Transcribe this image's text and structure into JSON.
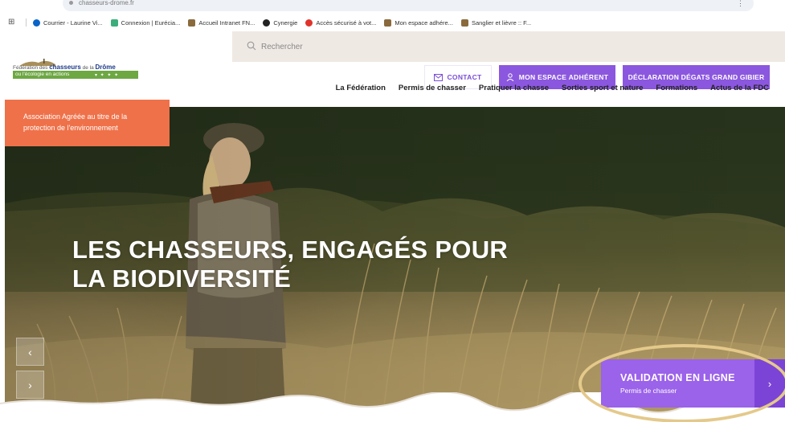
{
  "browser": {
    "url": "chasseurs-drome.fr"
  },
  "bookmarks": [
    {
      "label": "Courrier - Laurine Vi...",
      "icon": "outlook-icon",
      "color": "#0a64c8"
    },
    {
      "label": "Connexion | Eurécia...",
      "icon": "eurecia-icon",
      "color": "#3cae7b"
    },
    {
      "label": "Accueil Intranet FN...",
      "icon": "fnc-icon",
      "color": "#8a6a3c"
    },
    {
      "label": "Cynergie",
      "icon": "cynergie-icon",
      "color": "#222222"
    },
    {
      "label": "Accès sécurisé à vot...",
      "icon": "secure-icon",
      "color": "#e0332b"
    },
    {
      "label": "Mon espace adhére...",
      "icon": "fnc-icon",
      "color": "#8a6a3c"
    },
    {
      "label": "Sanglier et lièvre :: F...",
      "icon": "fnc-icon",
      "color": "#8a6a3c"
    }
  ],
  "logo": {
    "line1_prefix": "Fédération des",
    "line1_main": "chasseurs",
    "line1_mid": "de la",
    "line1_region": "Drôme",
    "line2": "ou l'écologie en actions"
  },
  "header": {
    "search_placeholder": "Rechercher",
    "contact_label": "CONTACT",
    "member_label": "MON ESPACE ADHÉRENT",
    "damage_label": "DÉCLARATION DÉGATS GRAND GIBIER",
    "accent_color": "#8b57df"
  },
  "nav": [
    "La Fédération",
    "Permis de chasser",
    "Pratiquer la chasse",
    "Sorties sport et nature",
    "Formations",
    "Actus de la FDC"
  ],
  "hero": {
    "badge_text": "Association Agréée au titre de la protection de l'environnement",
    "title_line1": "LES CHASSEURS, ENGAGÉS POUR",
    "title_line2": "LA BIODIVERSITÉ",
    "prev_icon": "‹",
    "next_icon": "›"
  },
  "cta": {
    "title": "VALIDATION EN LIGNE",
    "subtitle": "Permis de chasser",
    "arrow": "›"
  }
}
